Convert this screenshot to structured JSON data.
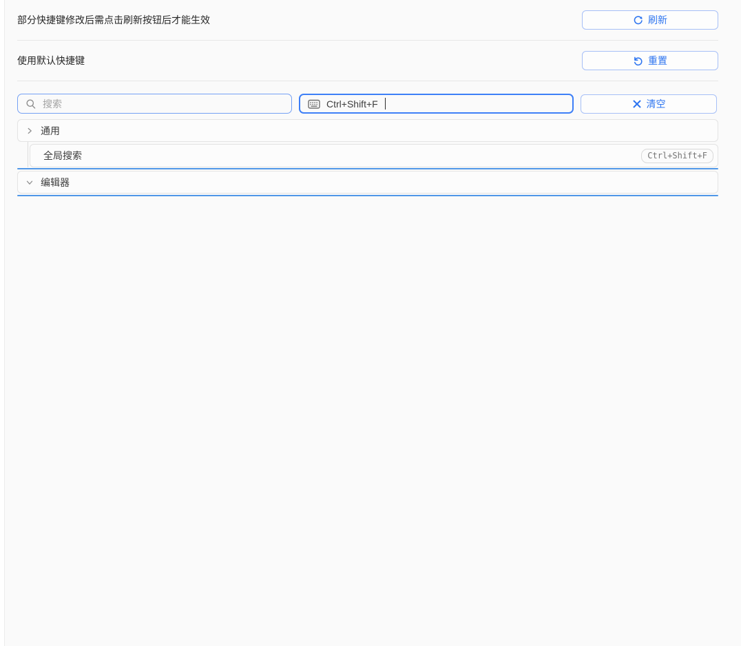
{
  "notice": {
    "text": "部分快捷键修改后需点击刷新按钮后才能生效",
    "refresh_label": "刷新"
  },
  "defaults": {
    "text": "使用默认快捷键",
    "reset_label": "重置"
  },
  "filter": {
    "search_placeholder": "搜索",
    "shortcut_value": "Ctrl+Shift+F",
    "clear_label": "清空"
  },
  "tree": {
    "groups": [
      {
        "label": "通用",
        "state": "collapsed",
        "children": [
          {
            "label": "全局搜索",
            "shortcut": "Ctrl+Shift+F"
          }
        ]
      },
      {
        "label": "编辑器",
        "state": "expanded",
        "children": []
      }
    ]
  },
  "icons": {
    "refresh_icon": "circular-arrows ⟳",
    "reset_icon": "undo-arc ↺",
    "clear_icon": "cross ✕",
    "search_icon": "magnifier 🔍",
    "keyboard_icon": "keyboard ⌨",
    "chevron_right_icon": "›",
    "chevron_down_icon": "⌄"
  },
  "colors": {
    "accent": "#2e75f0",
    "button_border": "#a6bff7",
    "search_border": "#74a0f4",
    "focus_border": "#3d7ff7",
    "highlight_line": "#4f97e8",
    "background": "#fafafa"
  }
}
